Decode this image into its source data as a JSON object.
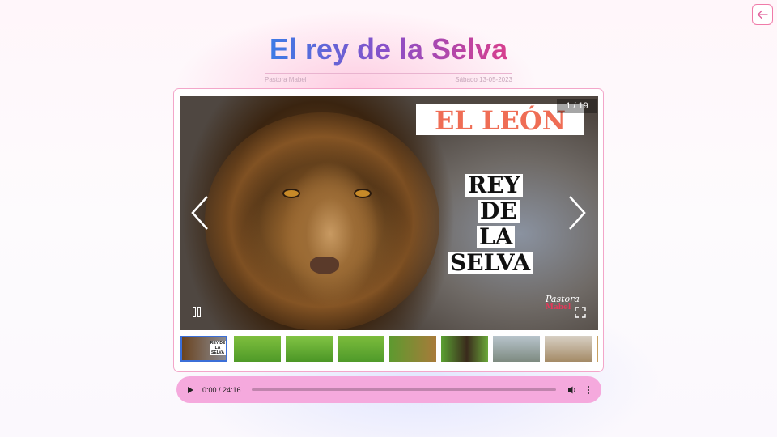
{
  "header": {
    "title": "El rey de la Selva",
    "author": "Pastora Mabel",
    "date": "Sábado 13-05-2023"
  },
  "navigation": {
    "back_icon": "arrow-left-icon"
  },
  "slideshow": {
    "counter": "1 / 19",
    "current_slide": {
      "banner": "EL LEÓN",
      "subtitle_lines": [
        "REY",
        "DE",
        "LA",
        "SELVA"
      ],
      "logo_lines": [
        "Pastora",
        "Mabel"
      ]
    },
    "controls": {
      "prev_icon": "chevron-left-icon",
      "next_icon": "chevron-right-icon",
      "pause_icon": "pause-icon",
      "fullscreen_icon": "fullscreen-icon"
    },
    "thumbnails": [
      {
        "label": "REY DE LA SELVA",
        "active": true
      },
      {
        "label": "",
        "active": false
      },
      {
        "label": "",
        "active": false
      },
      {
        "label": "",
        "active": false
      },
      {
        "label": "",
        "active": false
      },
      {
        "label": "",
        "active": false
      },
      {
        "label": "",
        "active": false
      },
      {
        "label": "",
        "active": false
      },
      {
        "label": "",
        "active": false
      }
    ]
  },
  "audio": {
    "time": "0:00 / 24:16",
    "progress": 0,
    "play_icon": "play-icon",
    "volume_icon": "volume-icon",
    "menu_icon": "more-vertical-icon"
  },
  "colors": {
    "title_gradient": [
      "#3d7be6",
      "#8a4fc8",
      "#d73f8e"
    ],
    "accent_pink": "#f5a9dd",
    "border_pink": "#f3a6c9",
    "banner_red": "#ef6d55",
    "thumb_active": "#3b6fd8"
  }
}
